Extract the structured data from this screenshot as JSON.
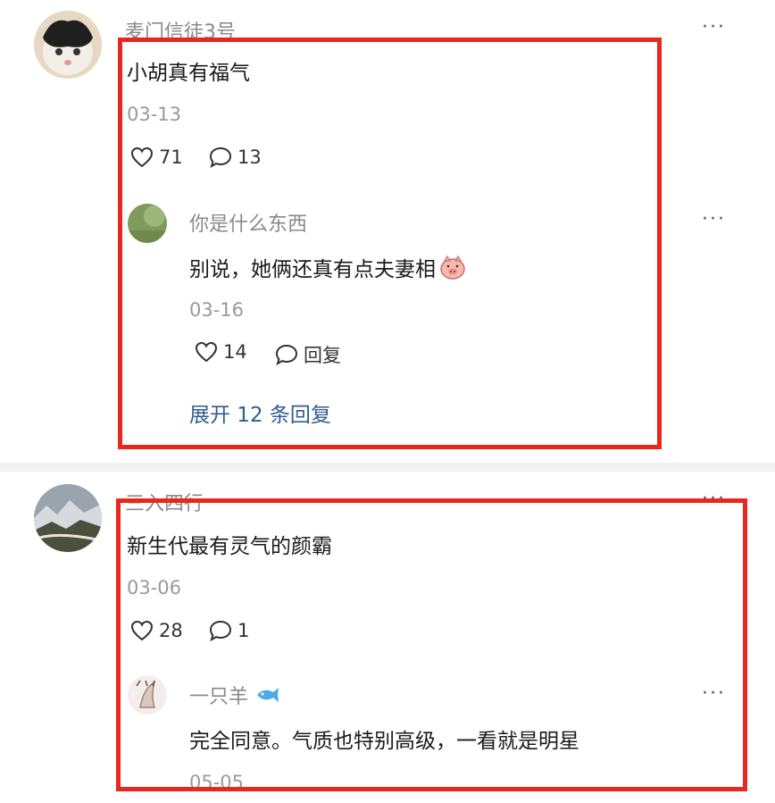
{
  "comments": [
    {
      "username": "麦门信徒3号",
      "text": "小胡真有福气",
      "date": "03-13",
      "likes": "71",
      "replies_count": "13",
      "more": "···",
      "reply": {
        "username": "你是什么东西",
        "text": "别说，她俩还真有点夫妻相",
        "emoji": "pig-face",
        "date": "03-16",
        "likes": "14",
        "reply_label": "回复",
        "more": "···"
      },
      "expand_label": "展开 12 条回复"
    },
    {
      "username": "三入四行",
      "text": "新生代最有灵气的颜霸",
      "date": "03-06",
      "likes": "28",
      "replies_count": "1",
      "more": "···",
      "reply": {
        "username": "一只羊",
        "badge": "fish",
        "text": "完全同意。气质也特别高级，一看就是明星",
        "date": "05-05",
        "more": "···"
      }
    }
  ],
  "colors": {
    "highlight_box": "#e8281e",
    "link": "#2f5d8f",
    "muted_text": "#9a9a9a"
  }
}
